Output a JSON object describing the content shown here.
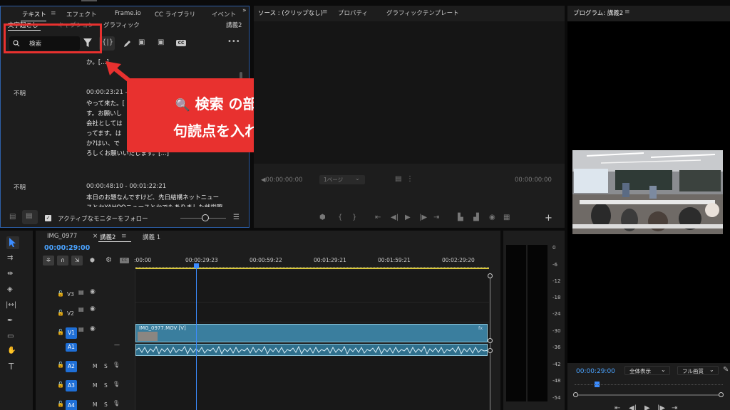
{
  "text_panel": {
    "tabs": [
      "テキスト",
      "エフェクト",
      "Frame.io",
      "CC ライブラリ",
      "イベント"
    ],
    "subtabs": [
      "文字起こし",
      "キャプション",
      "グラフィック"
    ],
    "sequence_name": "講義2",
    "search_placeholder": "検索",
    "transcript": [
      {
        "speaker": "",
        "time": "",
        "lines": [
          "か。[...]"
        ]
      },
      {
        "speaker": "不明",
        "time": "00:00:23:21 -",
        "lines": [
          "やって来た。[",
          "す。お願いし",
          "会社としては",
          "ってます。は",
          "か?はい、で",
          "ろしくお願いいたします。[...]"
        ]
      },
      {
        "speaker": "不明",
        "time": "00:00:48:10 - 00:01:22:21",
        "lines": [
          "本日のお題なんですけど、先日結構ネットニュー",
          "スとかYAHOOニュースとかでもありました就労際"
        ]
      }
    ],
    "follow_label": "アクティブなモニターをフォロー"
  },
  "callout": {
    "line1_icon": "🔍",
    "line1": "検索 の部分に",
    "line2": "句読点を入れます"
  },
  "source_panel": {
    "tabs": [
      "ソース : (クリップなし)",
      "プロパティ",
      "グラフィックテンプレート"
    ],
    "timecode_left": "00:00:00:00",
    "page_select": "1ページ",
    "timecode_right": "00:00:00:00"
  },
  "program_panel": {
    "title": "プログラム: 講義2",
    "timecode": "00:00:29:00",
    "fit_select": "全体表示",
    "quality_select": "フル画質"
  },
  "timeline": {
    "tabs": [
      "IMG_0977",
      "講義2",
      "講義 1"
    ],
    "active_tab": "講義2",
    "timecode": "00:00:29:00",
    "ruler": [
      ":00:00",
      "00:00:29:23",
      "00:00:59:22",
      "00:01:29:21",
      "00:01:59:21",
      "00:02:29:20"
    ],
    "tracks": [
      {
        "name": "V3",
        "type": "video",
        "active": false
      },
      {
        "name": "V2",
        "type": "video",
        "active": false
      },
      {
        "name": "V1",
        "type": "video",
        "active": true
      },
      {
        "name": "A1",
        "type": "audio",
        "active": true
      },
      {
        "name": "A2",
        "type": "audio",
        "active": true
      },
      {
        "name": "A3",
        "type": "audio",
        "active": true
      },
      {
        "name": "A4",
        "type": "audio",
        "active": true
      }
    ],
    "clip_label": "IMG_0977.MOV [V]",
    "track_m": "M",
    "track_s": "S"
  },
  "meter": {
    "labels": [
      "0",
      "-6",
      "-12",
      "-18",
      "-24",
      "-30",
      "-36",
      "-42",
      "-48",
      "-54"
    ]
  },
  "colors": {
    "accent": "#2d8cff",
    "callout_red": "#e8312f",
    "playhead": "#3b8cff",
    "clip_video": "#3a7e9e",
    "clip_audio": "#2f6f8c"
  }
}
